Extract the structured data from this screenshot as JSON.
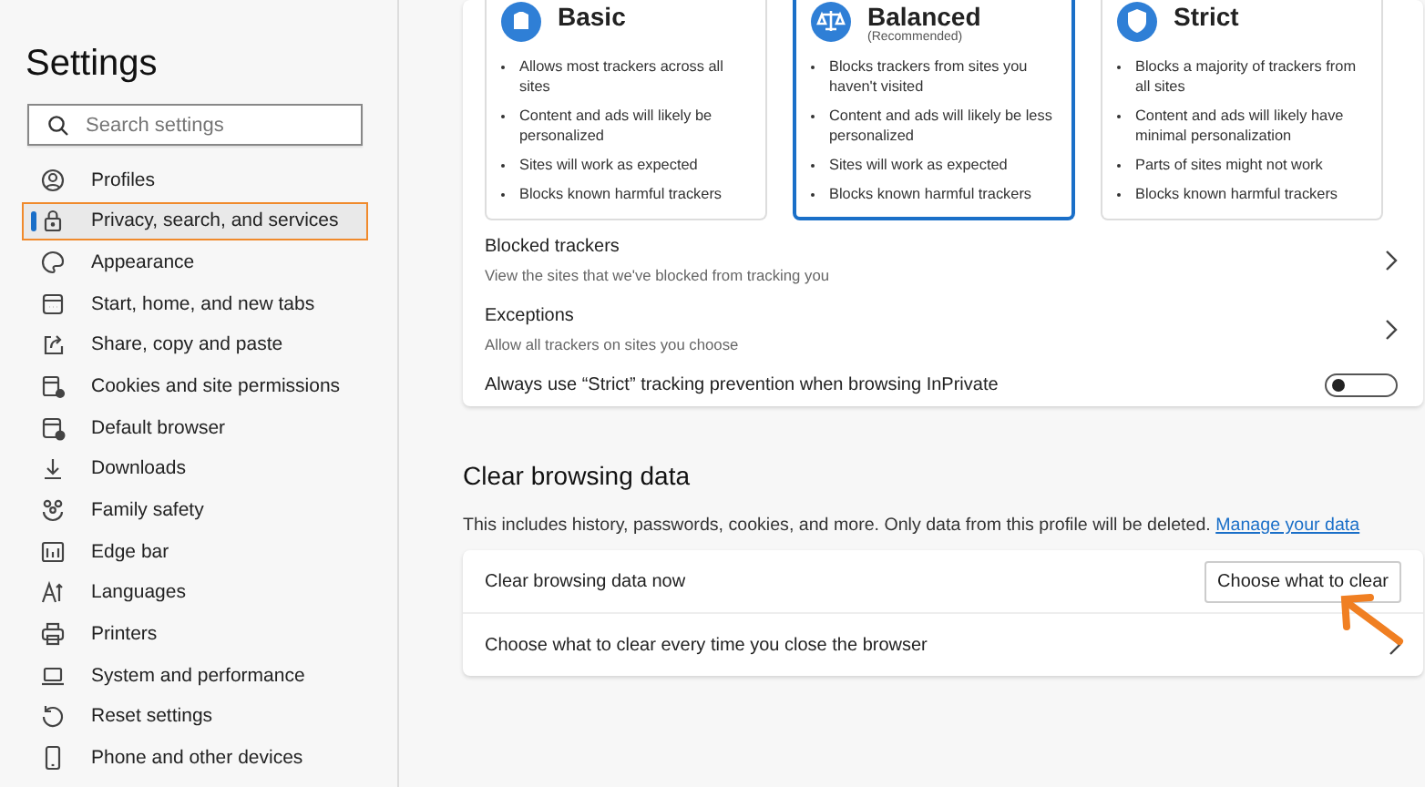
{
  "sidebar": {
    "title": "Settings",
    "search": {
      "placeholder": "Search settings"
    },
    "items": [
      {
        "label": "Profiles",
        "selected": false
      },
      {
        "label": "Privacy, search, and services",
        "selected": true
      },
      {
        "label": "Appearance",
        "selected": false
      },
      {
        "label": "Start, home, and new tabs",
        "selected": false
      },
      {
        "label": "Share, copy and paste",
        "selected": false
      },
      {
        "label": "Cookies and site permissions",
        "selected": false
      },
      {
        "label": "Default browser",
        "selected": false
      },
      {
        "label": "Downloads",
        "selected": false
      },
      {
        "label": "Family safety",
        "selected": false
      },
      {
        "label": "Edge bar",
        "selected": false
      },
      {
        "label": "Languages",
        "selected": false
      },
      {
        "label": "Printers",
        "selected": false
      },
      {
        "label": "System and performance",
        "selected": false
      },
      {
        "label": "Reset settings",
        "selected": false
      },
      {
        "label": "Phone and other devices",
        "selected": false
      }
    ]
  },
  "tracking_levels": [
    {
      "title": "Basic",
      "selected": false,
      "bullets": [
        "Allows most trackers across all sites",
        "Content and ads will likely be personalized",
        "Sites will work as expected",
        "Blocks known harmful trackers"
      ]
    },
    {
      "title": "Balanced",
      "subtitle": "(Recommended)",
      "selected": true,
      "bullets": [
        "Blocks trackers from sites you haven't visited",
        "Content and ads will likely be less personalized",
        "Sites will work as expected",
        "Blocks known harmful trackers"
      ]
    },
    {
      "title": "Strict",
      "selected": false,
      "bullets": [
        "Blocks a majority of trackers from all sites",
        "Content and ads will likely have minimal personalization",
        "Parts of sites might not work",
        "Blocks known harmful trackers"
      ]
    }
  ],
  "tracking_rows": [
    {
      "kind": "link",
      "label": "Blocked trackers",
      "description": "View the sites that we've blocked from tracking you"
    },
    {
      "kind": "link",
      "label": "Exceptions",
      "description": "Allow all trackers on sites you choose"
    },
    {
      "kind": "toggle",
      "label": "Always use “Strict” tracking prevention when browsing InPrivate",
      "on": false
    }
  ],
  "clear_browsing_data": {
    "heading": "Clear browsing data",
    "description": "This includes history, passwords, cookies, and more. Only data from this profile will be deleted.",
    "link": "Manage your data",
    "rows": [
      {
        "kind": "button",
        "label": "Clear browsing data now",
        "button": "Choose what to clear"
      },
      {
        "kind": "link",
        "label": "Choose what to clear every time you close the browser"
      }
    ]
  }
}
